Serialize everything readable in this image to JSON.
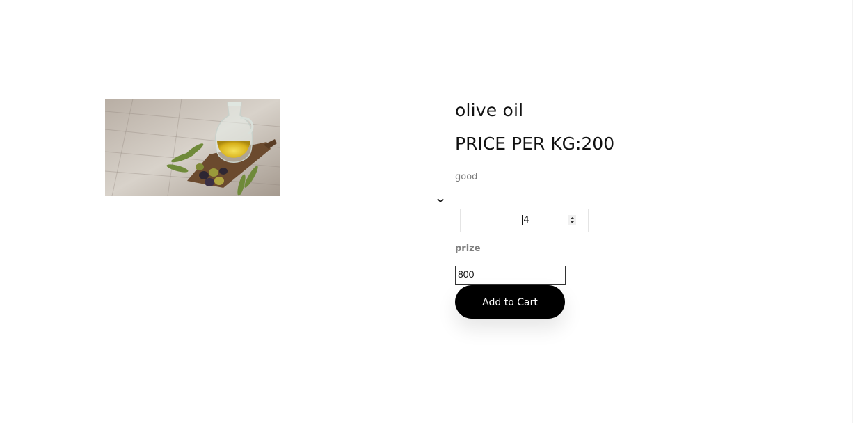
{
  "product": {
    "image_alt": "olive oil",
    "title": "olive oil",
    "price_line": "PRICE PER KG:200",
    "description": "good"
  },
  "quantity": {
    "value": "4",
    "icons": {
      "spinner_up": "triangle-up-icon",
      "spinner_down": "triangle-down-icon",
      "dropdown": "chevron-down-icon"
    }
  },
  "prize": {
    "label": "prize",
    "value": "800"
  },
  "actions": {
    "add_to_cart": "Add to Cart"
  },
  "colors": {
    "button_bg": "#000000",
    "button_text": "#ffffff",
    "muted_text": "#7a7a7a"
  }
}
